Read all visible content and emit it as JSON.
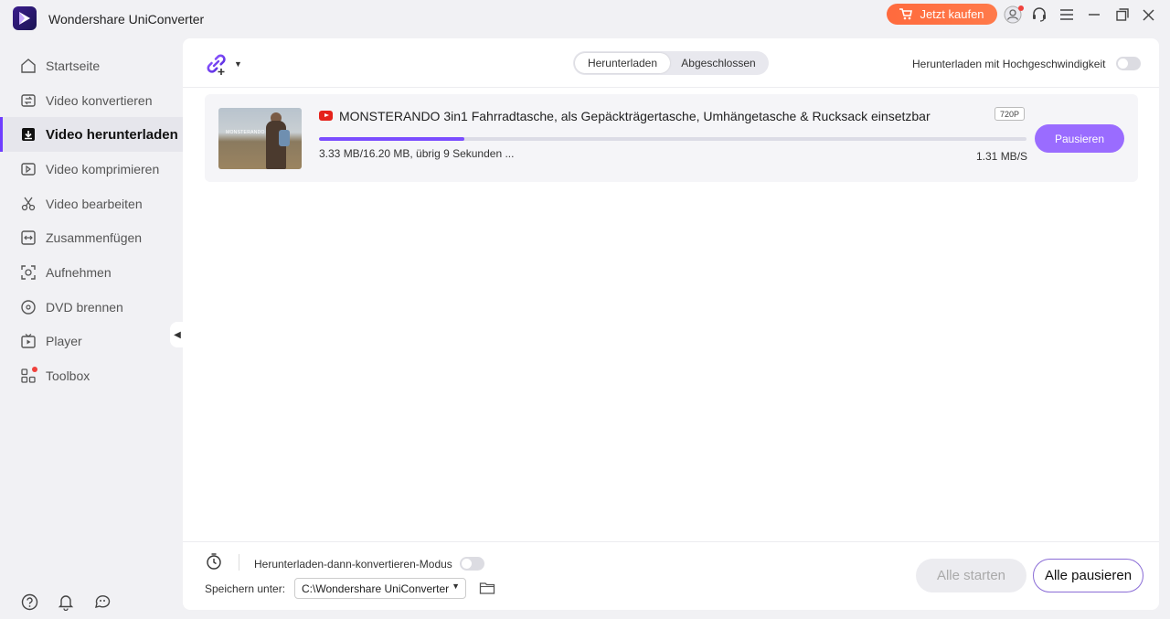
{
  "titlebar": {
    "app_title": "Wondershare UniConverter",
    "buy_label": "Jetzt kaufen",
    "brand_color": "#ff6a3d"
  },
  "sidebar": {
    "items": [
      {
        "label": "Startseite",
        "icon": "home-icon"
      },
      {
        "label": "Video konvertieren",
        "icon": "convert-icon"
      },
      {
        "label": "Video herunterladen",
        "icon": "download-icon",
        "active": true
      },
      {
        "label": "Video komprimieren",
        "icon": "compress-icon"
      },
      {
        "label": "Video bearbeiten",
        "icon": "scissors-icon"
      },
      {
        "label": "Zusammenfügen",
        "icon": "merge-icon"
      },
      {
        "label": "Aufnehmen",
        "icon": "record-icon"
      },
      {
        "label": "DVD brennen",
        "icon": "disc-icon"
      },
      {
        "label": "Player",
        "icon": "player-icon"
      },
      {
        "label": "Toolbox",
        "icon": "toolbox-icon"
      }
    ],
    "accent_color": "#6f3dff"
  },
  "main": {
    "tabs": [
      {
        "label": "Herunterladen",
        "active": true
      },
      {
        "label": "Abgeschlossen",
        "active": false
      }
    ],
    "highspeed_label": "Herunterladen mit Hochgeschwindigkeit"
  },
  "download": {
    "thumb_caption": "MONSTERANDO",
    "title": "MONSTERANDO 3in1 Fahrradtasche, als Gepäckträgertasche, Umhängetasche & Rucksack einsetzbar",
    "resolution": "720P",
    "progress_fraction": 0.2055,
    "size_status": "3.33 MB/16.20 MB, übrig 9 Sekunden ...",
    "speed": "1.31 MB/S",
    "pause_label": "Pausieren"
  },
  "footer": {
    "mode_label": "Herunterladen-dann-konvertieren-Modus",
    "save_label": "Speichern unter:",
    "save_path": "C:\\Wondershare UniConverter",
    "start_all_label": "Alle starten",
    "pause_all_label": "Alle pausieren"
  }
}
